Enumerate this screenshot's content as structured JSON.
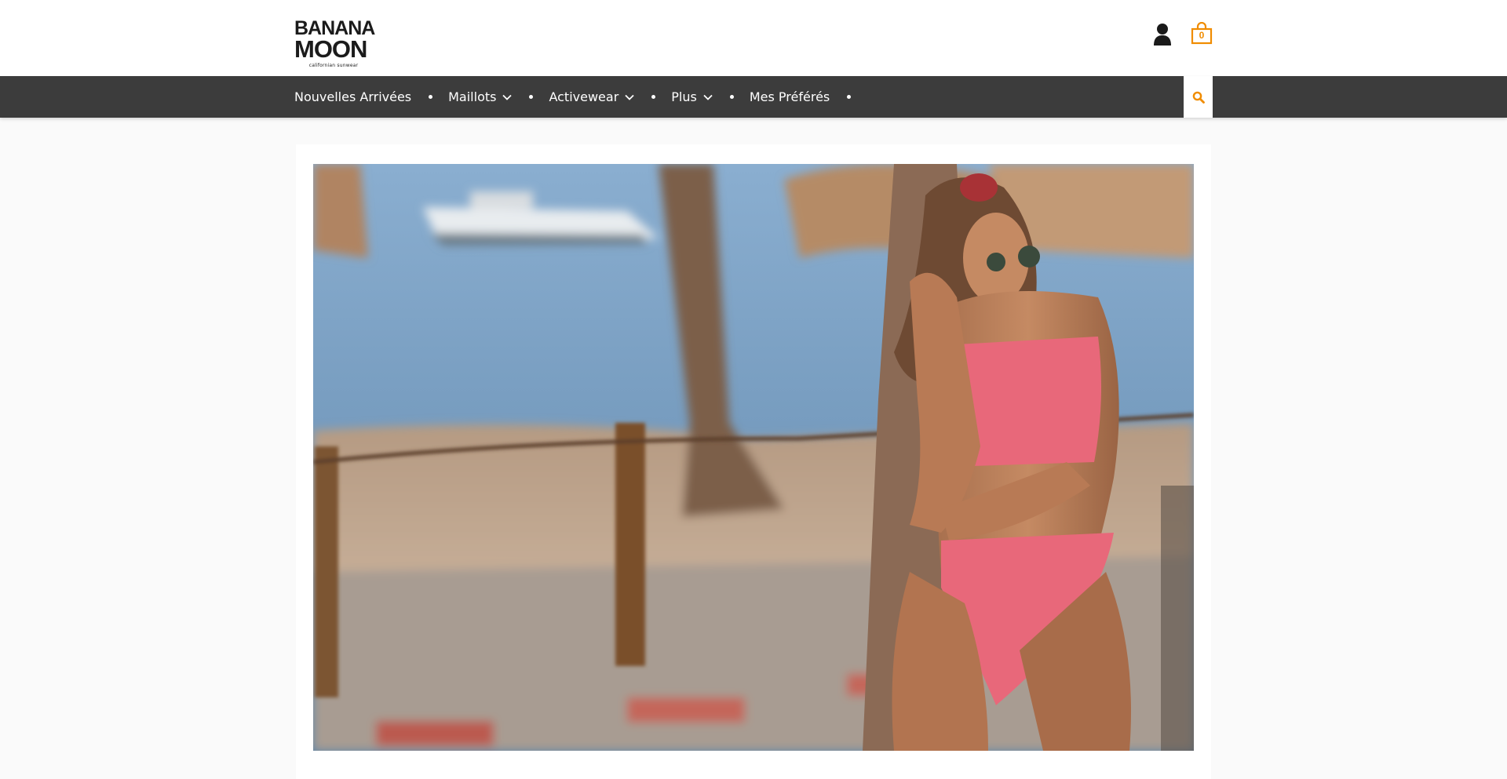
{
  "brand": {
    "logo_line1": "BANANA",
    "logo_line2": "MOON",
    "logo_tagline": "californian sunwear"
  },
  "header": {
    "account_icon": "user-icon",
    "cart_icon": "shopping-bag-icon",
    "cart_count": "0"
  },
  "nav": {
    "items": [
      {
        "label": "Nouvelles Arrivées",
        "has_dropdown": false
      },
      {
        "label": "Maillots",
        "has_dropdown": true
      },
      {
        "label": "Activewear",
        "has_dropdown": true
      },
      {
        "label": "Plus",
        "has_dropdown": true
      },
      {
        "label": "Mes Préférés",
        "has_dropdown": false
      }
    ],
    "search_icon": "search-icon"
  },
  "hero": {
    "image": "beach-model-pink-bikini"
  },
  "colors": {
    "accent": "#f08c00",
    "nav_bg": "#3c3c3c",
    "page_bg": "#fafafa"
  }
}
